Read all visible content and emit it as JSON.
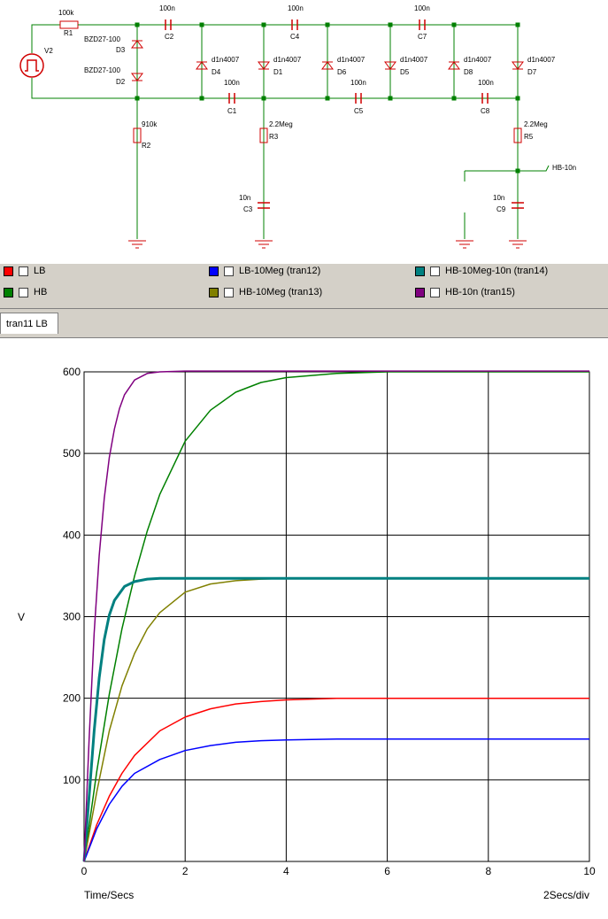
{
  "schematic": {
    "components": [
      {
        "name": "R1",
        "value": "100k"
      },
      {
        "name": "V2",
        "value": ""
      },
      {
        "name": "D3",
        "value": "BZD27-100"
      },
      {
        "name": "D2",
        "value": "BZD27-100"
      },
      {
        "name": "C2",
        "value": "100n"
      },
      {
        "name": "C1",
        "value": "100n"
      },
      {
        "name": "D4",
        "value": "d1n4007"
      },
      {
        "name": "D1",
        "value": "d1n4007"
      },
      {
        "name": "C4",
        "value": "100n"
      },
      {
        "name": "C5",
        "value": "100n"
      },
      {
        "name": "D6",
        "value": "d1n4007"
      },
      {
        "name": "D5",
        "value": "d1n4007"
      },
      {
        "name": "C7",
        "value": "100n"
      },
      {
        "name": "C8",
        "value": "100n"
      },
      {
        "name": "D8",
        "value": "d1n4007"
      },
      {
        "name": "D7",
        "value": "d1n4007"
      },
      {
        "name": "R2",
        "value": "910k"
      },
      {
        "name": "R3",
        "value": "2.2Meg"
      },
      {
        "name": "C3",
        "value": "10n"
      },
      {
        "name": "R5",
        "value": "2.2Meg"
      },
      {
        "name": "C9",
        "value": "10n"
      }
    ],
    "probe_label": "HB-10n"
  },
  "legend": [
    {
      "label": "LB",
      "color": "#ff0000"
    },
    {
      "label": "HB",
      "color": "#008000"
    },
    {
      "label": "LB-10Meg (tran12)",
      "color": "#0000ff"
    },
    {
      "label": "HB-10Meg (tran13)",
      "color": "#808000"
    },
    {
      "label": "HB-10Meg-10n (tran14)",
      "color": "#008080"
    },
    {
      "label": "HB-10n (tran15)",
      "color": "#800080"
    }
  ],
  "tab": {
    "label": "tran11 LB"
  },
  "chart_data": {
    "type": "line",
    "xlabel": "Time/Secs",
    "xscale_label": "2Secs/div",
    "ylabel": "V",
    "xlim": [
      0,
      10
    ],
    "ylim": [
      0,
      600
    ],
    "xticks": [
      0,
      2,
      4,
      6,
      8,
      10
    ],
    "yticks": [
      100,
      200,
      300,
      400,
      500,
      600
    ],
    "grid": true,
    "series": [
      {
        "name": "LB",
        "color": "#ff0000",
        "x": [
          0,
          0.25,
          0.5,
          0.75,
          1,
          1.5,
          2,
          2.5,
          3,
          3.5,
          4,
          5,
          6,
          8,
          10
        ],
        "values": [
          0,
          45,
          80,
          108,
          130,
          160,
          177,
          187,
          193,
          196,
          198,
          200,
          200,
          200,
          200
        ]
      },
      {
        "name": "HB",
        "color": "#008000",
        "x": [
          0,
          0.25,
          0.5,
          0.75,
          1,
          1.25,
          1.5,
          2,
          2.5,
          3,
          3.5,
          4,
          5,
          6,
          8,
          10
        ],
        "values": [
          0,
          110,
          205,
          285,
          350,
          405,
          450,
          515,
          553,
          575,
          587,
          593,
          598,
          600,
          600,
          600
        ]
      },
      {
        "name": "LB-10Meg (tran12)",
        "color": "#0000ff",
        "x": [
          0,
          0.25,
          0.5,
          0.75,
          1,
          1.5,
          2,
          2.5,
          3,
          3.5,
          4,
          5,
          6,
          8,
          10
        ],
        "values": [
          0,
          40,
          70,
          92,
          108,
          125,
          136,
          142,
          146,
          148,
          149,
          150,
          150,
          150,
          150
        ]
      },
      {
        "name": "HB-10Meg (tran13)",
        "color": "#808000",
        "x": [
          0,
          0.25,
          0.5,
          0.75,
          1,
          1.25,
          1.5,
          2,
          2.5,
          3,
          3.5,
          4,
          6,
          8,
          10
        ],
        "values": [
          0,
          85,
          160,
          215,
          255,
          285,
          305,
          330,
          340,
          344,
          346,
          347,
          347,
          347,
          347
        ]
      },
      {
        "name": "HB-10Meg-10n (tran14)",
        "color": "#008080",
        "x": [
          0,
          0.1,
          0.2,
          0.3,
          0.4,
          0.5,
          0.6,
          0.8,
          1,
          1.25,
          1.5,
          2,
          3,
          4,
          6,
          8,
          10
        ],
        "values": [
          0,
          80,
          160,
          225,
          272,
          302,
          320,
          337,
          343,
          346,
          347,
          347,
          347,
          347,
          347,
          347,
          347
        ]
      },
      {
        "name": "HB-10n (tran15)",
        "color": "#800080",
        "x": [
          0,
          0.1,
          0.2,
          0.3,
          0.4,
          0.5,
          0.6,
          0.7,
          0.8,
          1,
          1.25,
          1.5,
          2,
          3,
          4,
          6,
          8,
          10
        ],
        "values": [
          0,
          150,
          280,
          375,
          445,
          495,
          530,
          555,
          572,
          590,
          598,
          600,
          601,
          601,
          601,
          601,
          601,
          601
        ]
      }
    ]
  }
}
